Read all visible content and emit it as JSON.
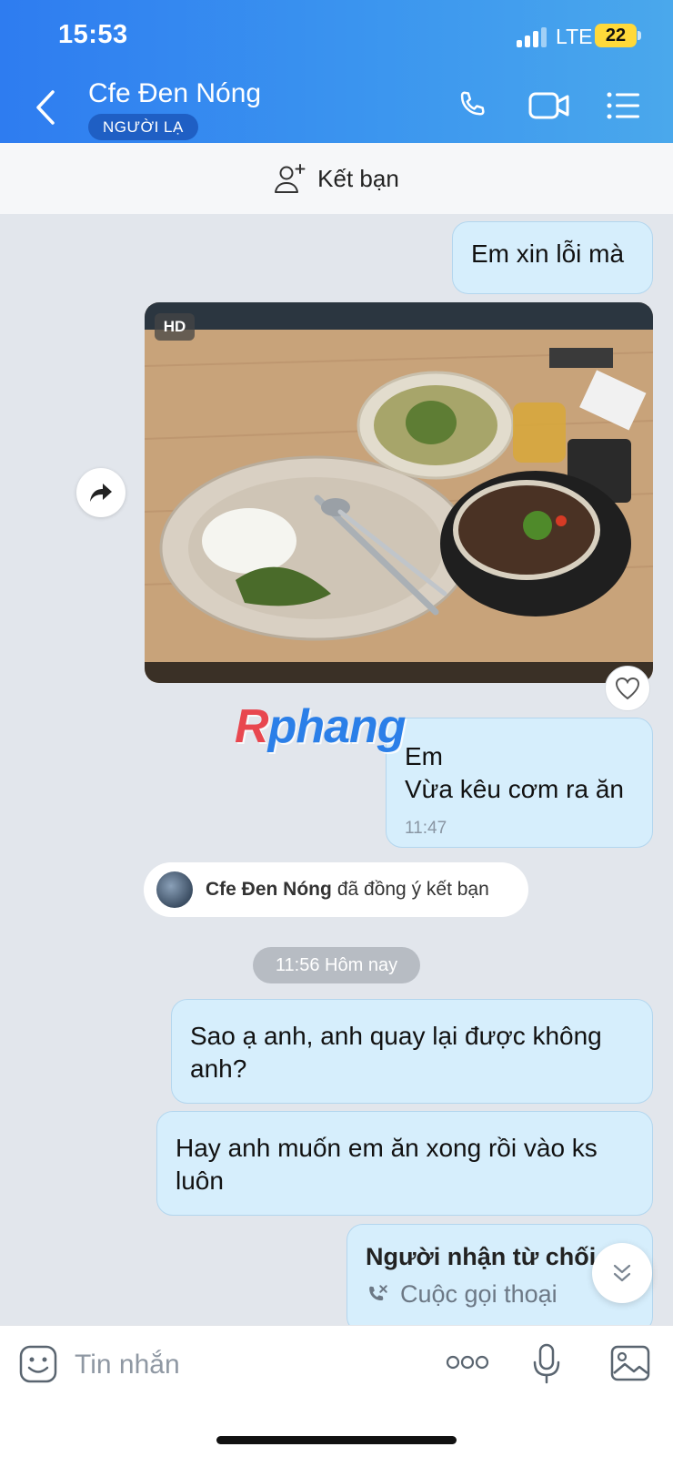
{
  "status_bar": {
    "time": "15:53",
    "network": "LTE",
    "battery": "22"
  },
  "header": {
    "contact_name": "Cfe Đen Nóng",
    "badge": "NGƯỜI LẠ"
  },
  "add_friend": {
    "label": "Kết bạn"
  },
  "messages": {
    "m1": "Em xin lỗi mà",
    "photo_badge": "HD",
    "m2_line1": "Em",
    "m2_line2": "Vừa kêu cơm ra ăn",
    "m2_time": "11:47",
    "friend_notice_name": "Cfe Đen Nóng",
    "friend_notice_text": "đã đồng ý kết bạn",
    "date_separator": "11:56 Hôm nay",
    "m3": "Sao ạ anh, anh quay lại được không anh?",
    "m4": "Hay anh muốn em ăn xong rồi vào ks luôn",
    "call_title": "Người nhận từ chối",
    "call_sub": "Cuộc gọi thoại"
  },
  "watermark": {
    "first": "R",
    "rest": "phang"
  },
  "composer": {
    "placeholder": "Tin nhắn"
  },
  "colors": {
    "header_start": "#2e7cf0",
    "header_end": "#4aa8ec",
    "bubble": "#d6eefc",
    "background": "#e2e6ec"
  }
}
